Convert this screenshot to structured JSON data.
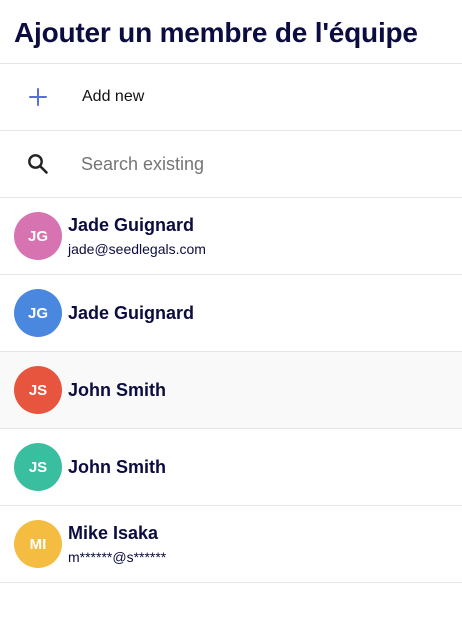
{
  "dialog": {
    "title": "Ajouter un membre de l'équipe"
  },
  "actions": {
    "add_new": {
      "label": "Add new",
      "icon": "plus-icon",
      "icon_color": "#5b6be0"
    },
    "search": {
      "placeholder": "Search existing",
      "icon": "search-icon"
    }
  },
  "members": [
    {
      "initials": "JG",
      "name": "Jade Guignard",
      "email": "jade@seedlegals.com",
      "color": "#d673b0",
      "highlighted": false
    },
    {
      "initials": "JG",
      "name": "Jade Guignard",
      "email": "",
      "color": "#4a88df",
      "highlighted": false
    },
    {
      "initials": "JS",
      "name": "John Smith",
      "email": "",
      "color": "#e8553f",
      "highlighted": true
    },
    {
      "initials": "JS",
      "name": "John Smith",
      "email": "",
      "color": "#39bf9f",
      "highlighted": false
    },
    {
      "initials": "MI",
      "name": "Mike Isaka",
      "email": "m******@s******",
      "color": "#f4bd42",
      "highlighted": false
    }
  ]
}
